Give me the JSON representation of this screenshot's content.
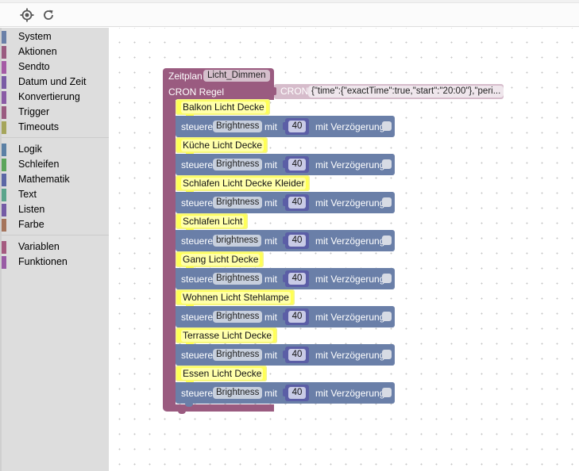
{
  "toolbar": {
    "buttons": [
      {
        "name": "center-icon",
        "title": "crosshair"
      },
      {
        "name": "refresh-icon",
        "title": "reload"
      }
    ]
  },
  "sidebar": {
    "groups": [
      [
        {
          "label": "System",
          "color": "#6a80a8"
        },
        {
          "label": "Aktionen",
          "color": "#9a5b80"
        },
        {
          "label": "Sendto",
          "color": "#a55ba5"
        },
        {
          "label": "Datum und Zeit",
          "color": "#7a5ba5"
        },
        {
          "label": "Konvertierung",
          "color": "#8a5ba5"
        },
        {
          "label": "Trigger",
          "color": "#9a5b80"
        },
        {
          "label": "Timeouts",
          "color": "#a5a55b"
        }
      ],
      [
        {
          "label": "Logik",
          "color": "#5b80a5"
        },
        {
          "label": "Schleifen",
          "color": "#5ba55b"
        },
        {
          "label": "Mathematik",
          "color": "#5b67a5"
        },
        {
          "label": "Text",
          "color": "#5ba58c"
        },
        {
          "label": "Listen",
          "color": "#745ba5"
        },
        {
          "label": "Farbe",
          "color": "#a5745b"
        }
      ],
      [
        {
          "label": "Variablen",
          "color": "#a55b80"
        },
        {
          "label": "Funktionen",
          "color": "#995ba5"
        }
      ]
    ]
  },
  "workspace": {
    "schedule": {
      "label": "Zeitplan",
      "name": "Licht_Dimmen",
      "cron_rule_label": "CRON Regel",
      "cron_label": "CRON",
      "cron_value": "{\"time\":{\"exactTime\":true,\"start\":\"20:00\"},\"peri...",
      "color": "#9a5b80"
    },
    "actions": [
      {
        "comment": "Balkon Licht Decke",
        "verb": "steuere",
        "state": "Brightness",
        "with": "mit",
        "value": "40",
        "delay": "mit Verzögerung",
        "delay_checked": false
      },
      {
        "comment": "Küche Licht Decke",
        "verb": "steuere",
        "state": "Brightness",
        "with": "mit",
        "value": "40",
        "delay": "mit Verzögerung",
        "delay_checked": false
      },
      {
        "comment": "Schlafen Licht Decke Kleider",
        "verb": "steuere",
        "state": "Brightness",
        "with": "mit",
        "value": "40",
        "delay": "mit Verzögerung",
        "delay_checked": false
      },
      {
        "comment": "Schlafen Licht",
        "verb": "steuere",
        "state": "brightness",
        "with": "mit",
        "value": "40",
        "delay": "mit Verzögerung",
        "delay_checked": false
      },
      {
        "comment": "Gang Licht Decke",
        "verb": "steuere",
        "state": "Brightness",
        "with": "mit",
        "value": "40",
        "delay": "mit Verzögerung",
        "delay_checked": false
      },
      {
        "comment": "Wohnen Licht Stehlampe",
        "verb": "steuere",
        "state": "Brightness",
        "with": "mit",
        "value": "40",
        "delay": "mit Verzögerung",
        "delay_checked": false
      },
      {
        "comment": "Terrasse Licht Decke",
        "verb": "steuere",
        "state": "Brightness",
        "with": "mit",
        "value": "40",
        "delay": "mit Verzögerung",
        "delay_checked": false
      },
      {
        "comment": "Essen Licht Decke",
        "verb": "steuere",
        "state": "Brightness",
        "with": "mit",
        "value": "40",
        "delay": "mit Verzögerung",
        "delay_checked": false
      }
    ]
  }
}
